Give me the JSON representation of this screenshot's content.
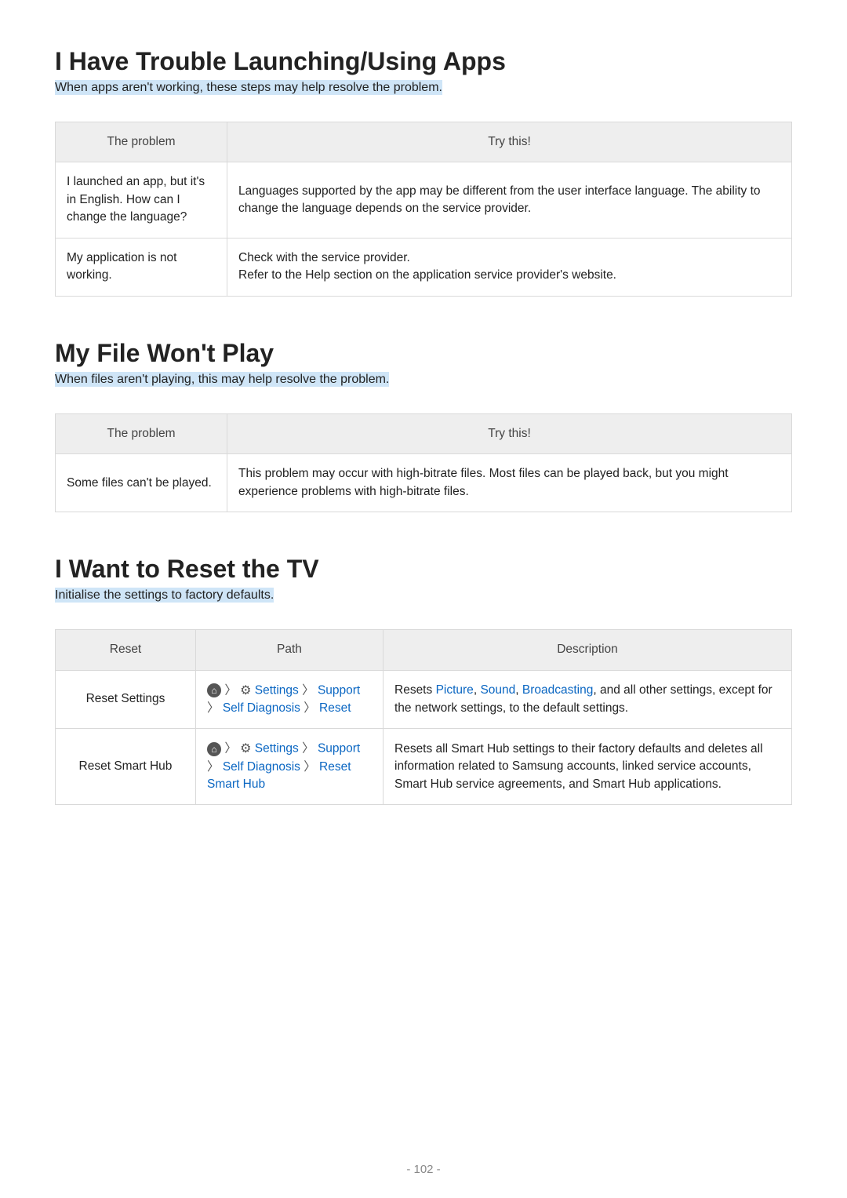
{
  "sections": [
    {
      "title": "I Have Trouble Launching/Using Apps",
      "subtitle": "When apps aren't working, these steps may help resolve the problem.",
      "headers": [
        "The problem",
        "Try this!"
      ],
      "rows": [
        {
          "problem": "I launched an app, but it's in English. How can I change the language?",
          "solution": "Languages supported by the app may be different from the user interface language. The ability to change the language depends on the service provider."
        },
        {
          "problem": "My application is not working.",
          "solution": "Check with the service provider.\nRefer to the Help section on the application service provider's website."
        }
      ]
    },
    {
      "title": "My File Won't Play",
      "subtitle": "When files aren't playing, this may help resolve the problem.",
      "headers": [
        "The problem",
        "Try this!"
      ],
      "rows": [
        {
          "problem": "Some files can't be played.",
          "solution": "This problem may occur with high-bitrate files. Most files can be played back, but you might experience problems with high-bitrate files."
        }
      ]
    }
  ],
  "reset_section": {
    "title": "I Want to Reset the TV",
    "subtitle": "Initialise the settings to factory defaults.",
    "headers": [
      "Reset",
      "Path",
      "Description"
    ],
    "rows": [
      {
        "name": "Reset Settings",
        "path_links": [
          "Settings",
          "Support",
          "Self Diagnosis",
          "Reset"
        ],
        "desc_pre": "Resets ",
        "desc_links": [
          "Picture",
          "Sound",
          "Broadcasting"
        ],
        "desc_post": ", and all other settings, except for the network settings, to the default settings."
      },
      {
        "name": "Reset Smart Hub",
        "path_links": [
          "Settings",
          "Support",
          "Self Diagnosis",
          "Reset Smart Hub"
        ],
        "desc_full": "Resets all Smart Hub settings to their factory defaults and deletes all information related to Samsung accounts, linked service accounts, Smart Hub service agreements, and Smart Hub applications."
      }
    ]
  },
  "page_number": "- 102 -"
}
